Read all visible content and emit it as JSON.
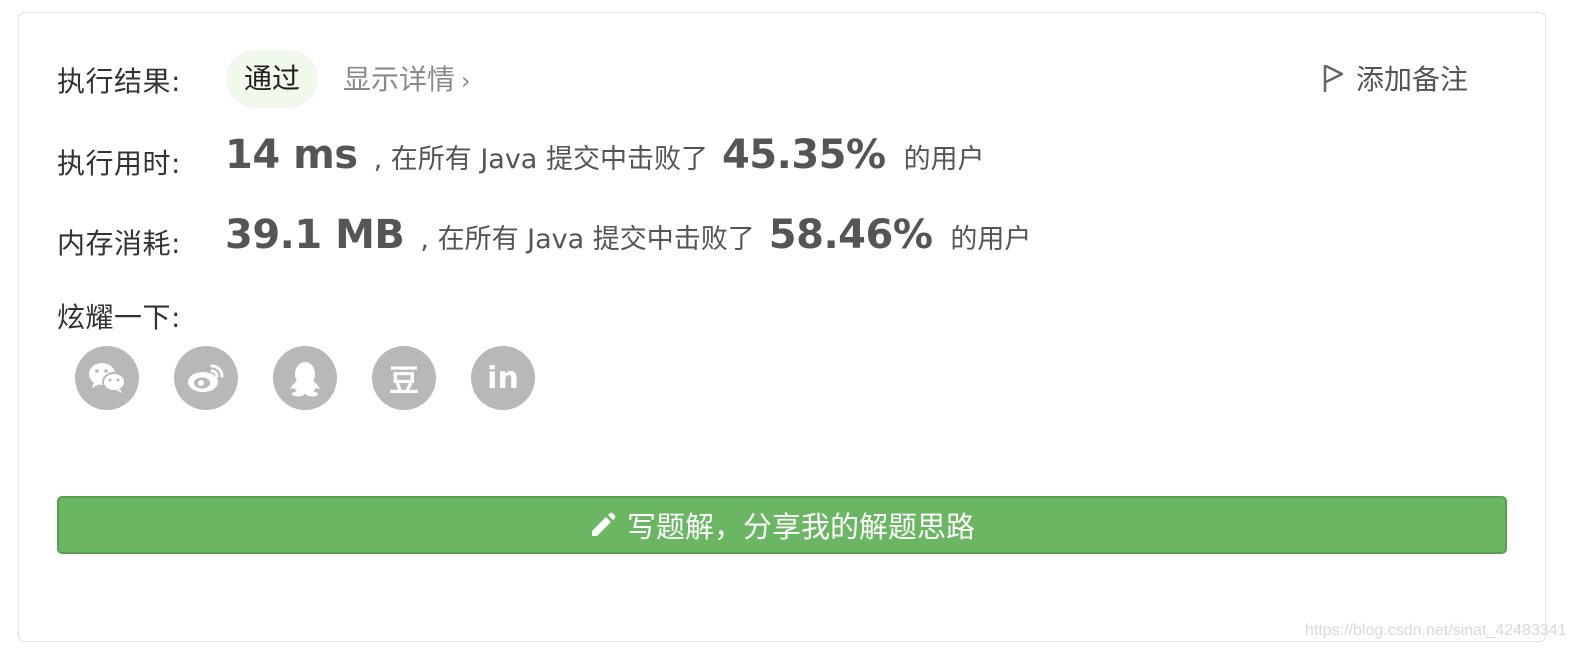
{
  "result": {
    "label": "执行结果:",
    "status": "通过",
    "details_link": "显示详情",
    "add_note": "添加备注"
  },
  "runtime": {
    "label": "执行用时:",
    "value": "14 ms",
    "middle_text": ", 在所有 Java 提交中击败了",
    "percent": "45.35%",
    "suffix": "的用户"
  },
  "memory": {
    "label": "内存消耗:",
    "value": "39.1 MB",
    "middle_text": ", 在所有 Java 提交中击败了",
    "percent": "58.46%",
    "suffix": "的用户"
  },
  "share": {
    "label": "炫耀一下:",
    "icons": [
      "wechat-icon",
      "weibo-icon",
      "qq-icon",
      "douban-icon",
      "linkedin-icon"
    ],
    "douban_glyph": "豆",
    "linkedin_glyph": "in"
  },
  "write_solution": {
    "label": "写题解，分享我的解题思路"
  },
  "watermark": "https://blog.csdn.net/sinat_42483341",
  "colors": {
    "accent_green": "#6ab663",
    "pill_bg": "#f1f8ec",
    "icon_gray": "#b8b8b8"
  }
}
